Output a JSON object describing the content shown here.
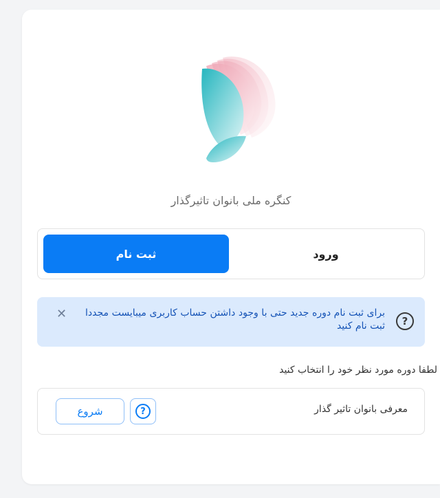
{
  "app": {
    "title": "کنگره ملی بانوان تاثیرگذار"
  },
  "tabs": {
    "login_label": "ورود",
    "register_label": "ثبت نام",
    "active": "register"
  },
  "alert": {
    "message": "برای ثبت نام دوره جدید حتی با وجود داشتن حساب کاربری میبایست مجددا ثبت نام کنید",
    "icon": "question-circle-icon",
    "close_icon": "close-icon"
  },
  "courses": {
    "prompt": "لطفا دوره مورد نظر خود را انتخاب کنید",
    "items": [
      {
        "name": "معرفی بانوان تاثیر گذار",
        "start_label": "شروع"
      }
    ]
  },
  "colors": {
    "primary": "#0a7cf5",
    "alert_bg": "#dbeafd",
    "alert_text": "#1553b6",
    "logo_teal": "#2bb9c0",
    "logo_pink": "#e8617a"
  }
}
